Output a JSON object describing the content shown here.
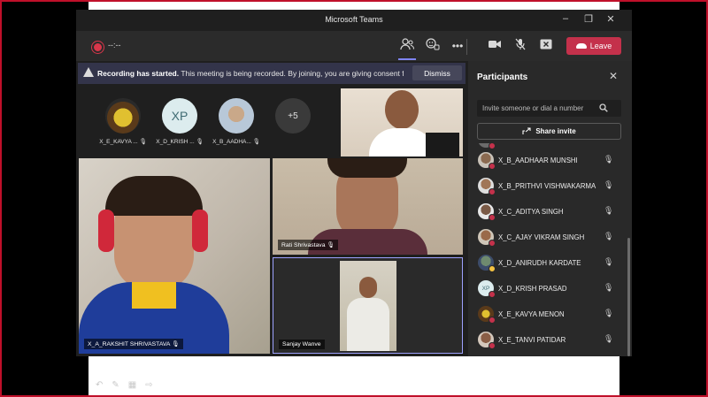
{
  "window": {
    "title": "Microsoft Teams"
  },
  "toolbar": {
    "timer": "--:--",
    "leave_label": "Leave"
  },
  "banner": {
    "bold": "Recording has started.",
    "text": "This meeting is being recorded. By joining, you are giving consent for...",
    "dismiss_label": "Dismiss"
  },
  "thumbnails": [
    {
      "name": "X_E_KAVYA ...",
      "initials": ""
    },
    {
      "name": "X_D_KRISH ...",
      "initials": "XP"
    },
    {
      "name": "X_B_AADHA...",
      "initials": ""
    }
  ],
  "overflow_count": "+5",
  "tiles": {
    "rakshit": "X_A_RAKSHIT SHRIVASTAVA",
    "rati": "Rati Shrivastava",
    "sanjay": "Sanjay Wanve"
  },
  "panel": {
    "title": "Participants",
    "invite_placeholder": "Invite someone or dial a number",
    "share_invite_label": "Share invite",
    "participants": [
      {
        "name": "X_B_AADHAAR MUNSHI",
        "initials": "",
        "status": "#c4314b"
      },
      {
        "name": "X_B_PRITHVI VISHWAKARMA",
        "initials": "",
        "status": "#c4314b"
      },
      {
        "name": "X_C_ADITYA SINGH",
        "initials": "",
        "status": "#c4314b"
      },
      {
        "name": "X_C_AJAY VIKRAM SINGH",
        "initials": "",
        "status": "#c4314b"
      },
      {
        "name": "X_D_ANIRUDH KARDATE",
        "initials": "",
        "status": "#f5c342"
      },
      {
        "name": "X_D_KRISH PRASAD",
        "initials": "XP",
        "status": "#c4314b"
      },
      {
        "name": "X_E_KAVYA MENON",
        "initials": "",
        "status": "#c4314b"
      },
      {
        "name": "X_E_TANVI PATIDAR",
        "initials": "",
        "status": "#c4314b"
      }
    ]
  },
  "colors": {
    "accent": "#7f85f5",
    "leave": "#c4314b",
    "banner_bg": "#33344a"
  }
}
